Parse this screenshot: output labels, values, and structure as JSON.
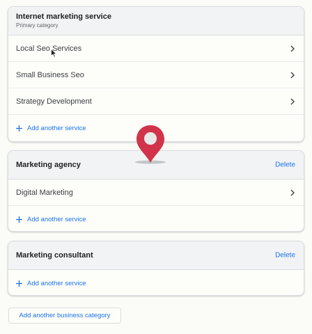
{
  "categories": [
    {
      "title": "Internet marketing service",
      "subtitle": "Primary category",
      "services": [
        "Local Seo Services",
        "Small Business Seo",
        "Strategy Development"
      ],
      "add_service_label": "Add another service"
    },
    {
      "title": "Marketing agency",
      "delete_label": "Delete",
      "services": [
        "Digital Marketing"
      ],
      "add_service_label": "Add another service"
    },
    {
      "title": "Marketing consultant",
      "delete_label": "Delete",
      "services": [],
      "add_service_label": "Add another service"
    }
  ],
  "add_category_label": "Add another business category",
  "icons": {
    "chevron": "chevron-right-icon",
    "plus": "plus-icon",
    "pin": "map-pin-icon",
    "cursor": "mouse-pointer-icon"
  },
  "colors": {
    "accent": "#1a73e8",
    "pin": "#d1344a",
    "header_bg": "#f1f3f4",
    "page_bg": "#fbfbf7"
  }
}
